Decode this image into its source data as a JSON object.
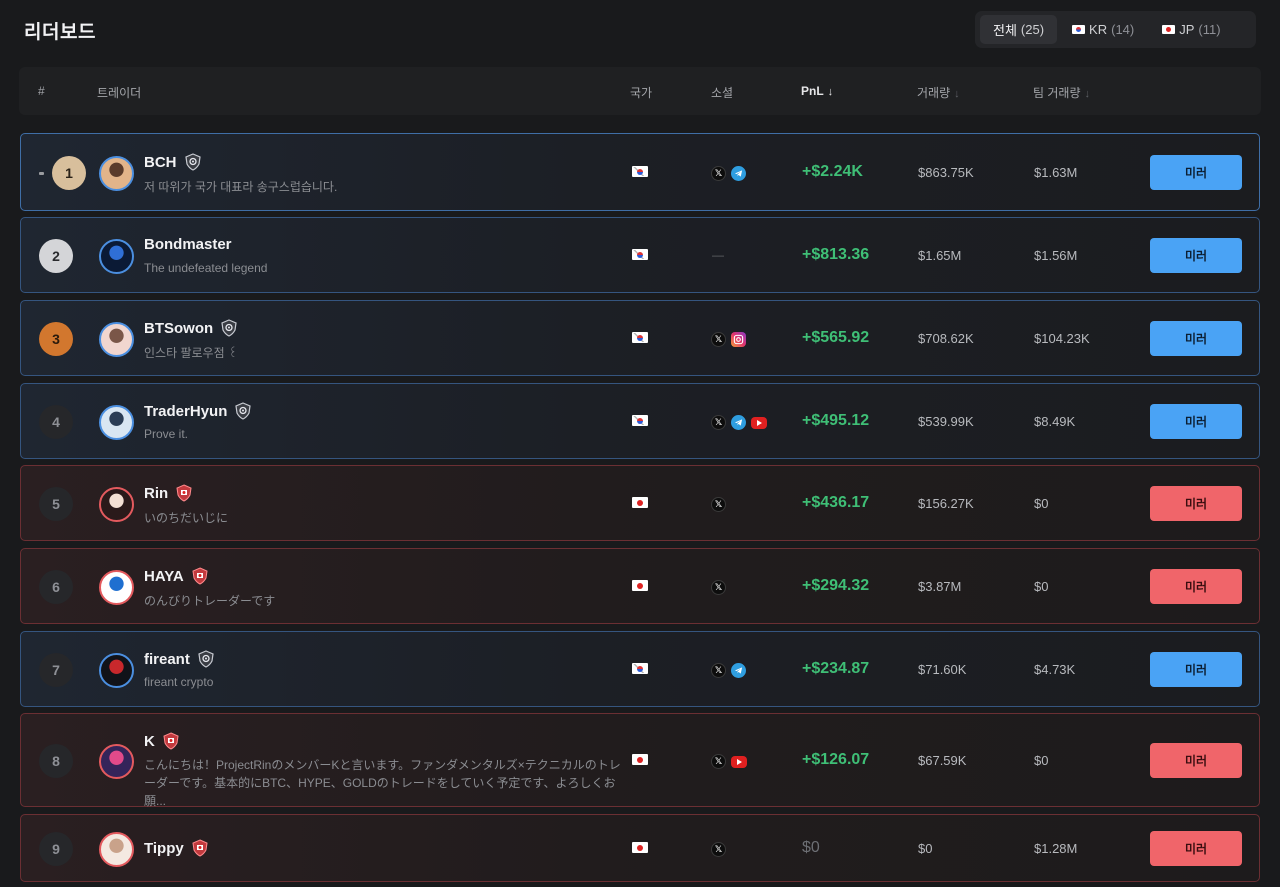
{
  "header": {
    "title": "리더보드",
    "filters": [
      {
        "label": "전체",
        "count": "(25)",
        "flag": "",
        "active": true
      },
      {
        "label": "KR",
        "count": "(14)",
        "flag": "kr",
        "active": false
      },
      {
        "label": "JP",
        "count": "(11)",
        "flag": "jp",
        "active": false
      }
    ]
  },
  "table": {
    "columns": {
      "rank": "#",
      "trader": "트레이더",
      "country": "국가",
      "social": "소셜",
      "pnl": "PnL",
      "volume": "거래량",
      "team_volume": "팀 거래량"
    },
    "sort_arrow": "↓",
    "rows": [
      {
        "rank": "1",
        "name": "BCH",
        "bio": "저 따위가 국가 대표라 송구스럽습니다.",
        "country": "kr",
        "badge": "shield",
        "socials": [
          "x",
          "telegram"
        ],
        "pnl": "+$2.24K",
        "volume": "$863.75K",
        "team_volume": "$1.63M",
        "button": "미러"
      },
      {
        "rank": "2",
        "name": "Bondmaster",
        "bio": "The undefeated legend",
        "country": "kr",
        "badge": "",
        "socials": [],
        "no_social": "—",
        "pnl": "+$813.36",
        "volume": "$1.65M",
        "team_volume": "$1.56M",
        "button": "미러"
      },
      {
        "rank": "3",
        "name": "BTSowon",
        "bio": "인스타 팔로우점 ꒰",
        "country": "kr",
        "badge": "shield",
        "socials": [
          "x",
          "instagram"
        ],
        "pnl": "+$565.92",
        "volume": "$708.62K",
        "team_volume": "$104.23K",
        "button": "미러"
      },
      {
        "rank": "4",
        "name": "TraderHyun",
        "bio": "Prove it.",
        "country": "kr",
        "badge": "shield",
        "socials": [
          "x",
          "telegram",
          "youtube"
        ],
        "pnl": "+$495.12",
        "volume": "$539.99K",
        "team_volume": "$8.49K",
        "button": "미러"
      },
      {
        "rank": "5",
        "name": "Rin",
        "bio": "いのちだいじに",
        "country": "jp",
        "badge": "jp-shield",
        "socials": [
          "x"
        ],
        "pnl": "+$436.17",
        "volume": "$156.27K",
        "team_volume": "$0",
        "button": "미러"
      },
      {
        "rank": "6",
        "name": "HAYA",
        "bio": "のんびりトレーダーです",
        "country": "jp",
        "badge": "jp-shield",
        "socials": [
          "x"
        ],
        "pnl": "+$294.32",
        "volume": "$3.87M",
        "team_volume": "$0",
        "button": "미러"
      },
      {
        "rank": "7",
        "name": "fireant",
        "bio": "fireant crypto",
        "country": "kr",
        "badge": "shield",
        "socials": [
          "x",
          "telegram"
        ],
        "pnl": "+$234.87",
        "volume": "$71.60K",
        "team_volume": "$4.73K",
        "button": "미러"
      },
      {
        "rank": "8",
        "name": "K",
        "bio": "こんにちは！ProjectRinのメンバーKと言います。ファンダメンタルズ×テクニカルのトレーダーです。基本的にBTC、HYPE、GOLDのトレードをしていく予定です、よろしくお願...",
        "country": "jp",
        "badge": "jp-shield",
        "socials": [
          "x",
          "youtube"
        ],
        "pnl": "+$126.07",
        "volume": "$67.59K",
        "team_volume": "$0",
        "button": "미러"
      },
      {
        "rank": "9",
        "name": "Tippy",
        "bio": "",
        "country": "jp",
        "badge": "jp-shield",
        "socials": [
          "x"
        ],
        "pnl": "$0",
        "volume": "$0",
        "team_volume": "$1.28M",
        "button": "미러"
      }
    ]
  },
  "colors": {
    "kr_accent": "#4aa3f5",
    "jp_accent": "#f0656a",
    "pnl_positive": "#3fbf76",
    "background": "#191a1c"
  }
}
